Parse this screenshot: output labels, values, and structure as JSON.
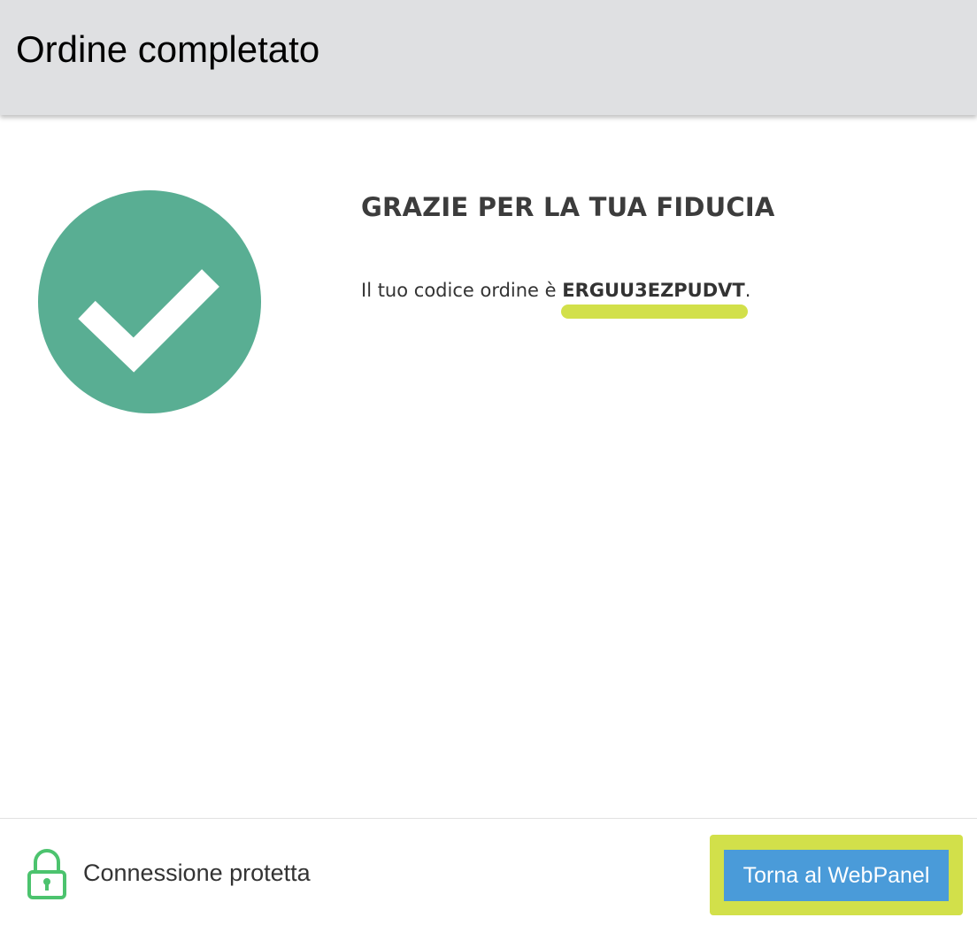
{
  "header": {
    "title": "Ordine completato"
  },
  "confirmation": {
    "title": "GRAZIE PER LA TUA FIDUCIA",
    "order_prefix": "Il tuo codice ordine è ",
    "order_code": "ERGUU3EZPUDVT",
    "order_suffix": "."
  },
  "footer": {
    "secure_label": "Connessione protetta",
    "back_button_label": "Torna al WebPanel"
  },
  "icons": {
    "success": "checkmark-circle-icon",
    "secure": "padlock-icon"
  },
  "colors": {
    "header_bg": "#dfe0e2",
    "success_green": "#59ae93",
    "highlight": "#d2e04a",
    "button_blue": "#4a9bd9",
    "lock_green": "#4cc36e"
  }
}
